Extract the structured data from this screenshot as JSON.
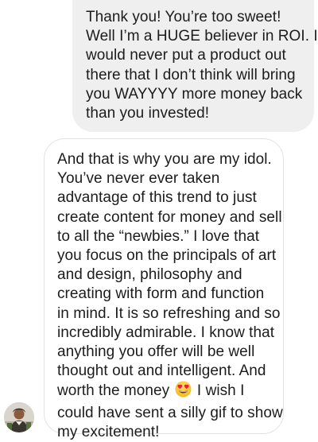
{
  "conversation": {
    "sent_message": {
      "lines": [
        "Thank you! You’re too sweet!",
        "Well I’m a HUGE believer in ROI. I",
        "would never put a product out",
        "there that I don’t think will bring",
        "you WAYYYY more money back",
        "than you invested!"
      ]
    },
    "received_message": {
      "lines": [
        "And that is why you are my idol.",
        "You’ve never ever taken",
        "advantage of this trend to just",
        "create content for money and sell",
        "to all the “newbies.” I love that",
        "you focus on the principals of art",
        "and design, philosophy and",
        "creating with form and function",
        "in mind. It is so refreshing and so",
        "incredibly admirable. I know that",
        "anything you offer will be well",
        "thought out and intelligent. And"
      ],
      "emoji_line_before": "worth the money",
      "emoji_name": "heart-eyes-emoji",
      "emoji_line_after": "I wish I",
      "final_lines": [
        "could have sent a silly gif to show",
        "my excitement!"
      ]
    },
    "sender_avatar": {
      "icon": "user-avatar"
    }
  }
}
